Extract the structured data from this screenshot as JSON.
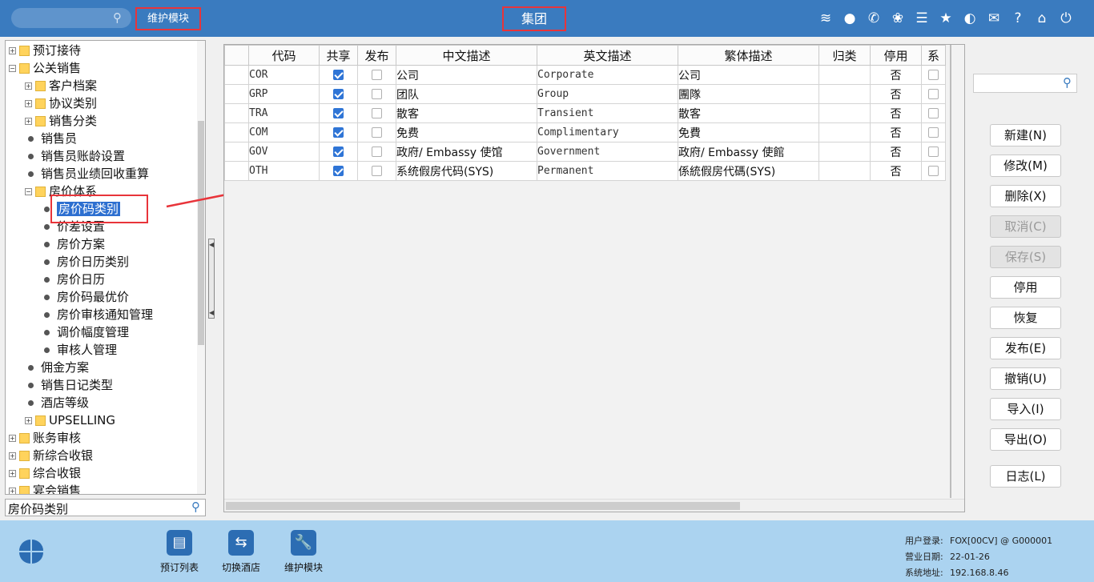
{
  "topbar": {
    "module_title": "维护模块",
    "group_title": "集团",
    "icons": [
      "wifi-icon",
      "chat-icon",
      "phone-icon",
      "palette-icon",
      "menu-icon",
      "star-icon",
      "contrast-icon",
      "mail-icon",
      "help-icon",
      "home-icon",
      "power-icon"
    ]
  },
  "tree": {
    "items": [
      {
        "label": "预订接待",
        "type": "folder",
        "level": 0,
        "toggle": "+"
      },
      {
        "label": "公关销售",
        "type": "folder",
        "level": 0,
        "toggle": "−"
      },
      {
        "label": "客户档案",
        "type": "folder",
        "level": 1,
        "toggle": "+"
      },
      {
        "label": "协议类别",
        "type": "folder",
        "level": 1,
        "toggle": "+"
      },
      {
        "label": "销售分类",
        "type": "folder",
        "level": 1,
        "toggle": "+"
      },
      {
        "label": "销售员",
        "type": "leaf",
        "level": 1
      },
      {
        "label": "销售员账龄设置",
        "type": "leaf",
        "level": 1
      },
      {
        "label": "销售员业绩回收重算",
        "type": "leaf",
        "level": 1
      },
      {
        "label": "房价体系",
        "type": "folder",
        "level": 1,
        "toggle": "−"
      },
      {
        "label": "房价码类别",
        "type": "leaf",
        "level": 2,
        "selected": true
      },
      {
        "label": "价差设置",
        "type": "leaf",
        "level": 2
      },
      {
        "label": "房价方案",
        "type": "leaf",
        "level": 2
      },
      {
        "label": "房价日历类别",
        "type": "leaf",
        "level": 2
      },
      {
        "label": "房价日历",
        "type": "leaf",
        "level": 2
      },
      {
        "label": "房价码最优价",
        "type": "leaf",
        "level": 2
      },
      {
        "label": "房价审核通知管理",
        "type": "leaf",
        "level": 2
      },
      {
        "label": "调价幅度管理",
        "type": "leaf",
        "level": 2
      },
      {
        "label": "审核人管理",
        "type": "leaf",
        "level": 2
      },
      {
        "label": "佣金方案",
        "type": "leaf",
        "level": 1
      },
      {
        "label": "销售日记类型",
        "type": "leaf",
        "level": 1
      },
      {
        "label": "酒店等级",
        "type": "leaf",
        "level": 1
      },
      {
        "label": "UPSELLING",
        "type": "folder",
        "level": 1,
        "toggle": "+"
      },
      {
        "label": "账务审核",
        "type": "folder",
        "level": 0,
        "toggle": "+"
      },
      {
        "label": "新综合收银",
        "type": "folder",
        "level": 0,
        "toggle": "+"
      },
      {
        "label": "综合收银",
        "type": "folder",
        "level": 0,
        "toggle": "+"
      },
      {
        "label": "宴会销售",
        "type": "folder",
        "level": 0,
        "toggle": "+"
      }
    ],
    "search_value": "房价码类别"
  },
  "grid": {
    "columns": [
      "",
      "代码",
      "共享",
      "发布",
      "中文描述",
      "英文描述",
      "繁体描述",
      "归类",
      "停用",
      "系"
    ],
    "rows": [
      {
        "code": "COR",
        "shared": true,
        "published": false,
        "cn": "公司",
        "en": "Corporate",
        "tw": "公司",
        "category": "",
        "disabled": "否"
      },
      {
        "code": "GRP",
        "shared": true,
        "published": false,
        "cn": "团队",
        "en": " Group",
        "tw": "團隊",
        "category": "",
        "disabled": "否"
      },
      {
        "code": "TRA",
        "shared": true,
        "published": false,
        "cn": "散客",
        "en": " Transient",
        "tw": "散客",
        "category": "",
        "disabled": "否"
      },
      {
        "code": "COM",
        "shared": true,
        "published": false,
        "cn": "免费",
        "en": "Complimentary",
        "tw": "免費",
        "category": "",
        "disabled": "否"
      },
      {
        "code": "GOV",
        "shared": true,
        "published": false,
        "cn": "政府/ Embassy 使馆",
        "en": "Government",
        "tw": "政府/ Embassy 使館",
        "category": "",
        "disabled": "否"
      },
      {
        "code": "OTH",
        "shared": true,
        "published": false,
        "cn": "系统假房代码(SYS)",
        "en": "Permanent",
        "tw": "係統假房代碼(SYS)",
        "category": "",
        "disabled": "否"
      }
    ]
  },
  "actions": [
    {
      "label": "新建(N)",
      "enabled": true
    },
    {
      "label": "修改(M)",
      "enabled": true
    },
    {
      "label": "删除(X)",
      "enabled": true
    },
    {
      "label": "取消(C)",
      "enabled": false
    },
    {
      "label": "保存(S)",
      "enabled": false
    },
    {
      "label": "停用",
      "enabled": true
    },
    {
      "label": "恢复",
      "enabled": true
    },
    {
      "label": "发布(E)",
      "enabled": true
    },
    {
      "label": "撤销(U)",
      "enabled": true
    },
    {
      "label": "导入(I)",
      "enabled": true
    },
    {
      "label": "导出(O)",
      "enabled": true
    },
    {
      "label": "日志(L)",
      "enabled": true
    }
  ],
  "taskbar": [
    {
      "label": "预订列表",
      "icon": "booking-list-icon"
    },
    {
      "label": "切换酒店",
      "icon": "switch-hotel-icon"
    },
    {
      "label": "维护模块",
      "icon": "maintenance-wrench-icon"
    }
  ],
  "status": {
    "user_label": "用户登录:",
    "user_value": "FOX[00CV] @ G000001",
    "date_label": "营业日期:",
    "date_value": "22-01-26",
    "addr_label": "系统地址:",
    "addr_value": "192.168.8.46"
  },
  "colors": {
    "topbar": "#3a7bbf",
    "bottombar": "#abd3f0",
    "highlight": "#e8343a",
    "selection": "#2d6fd0"
  }
}
